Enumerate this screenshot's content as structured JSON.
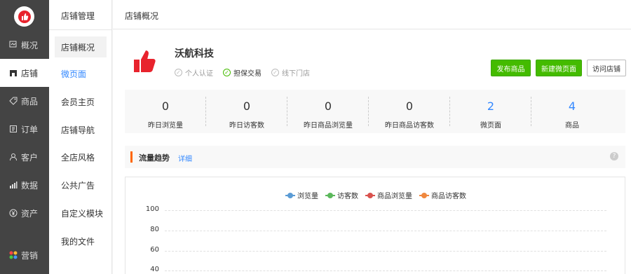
{
  "nav": {
    "items": [
      {
        "label": "概况",
        "icon": "overview-icon"
      },
      {
        "label": "店铺",
        "icon": "shop-icon"
      },
      {
        "label": "商品",
        "icon": "tag-icon"
      },
      {
        "label": "订单",
        "icon": "order-icon"
      },
      {
        "label": "客户",
        "icon": "user-icon"
      },
      {
        "label": "数据",
        "icon": "bar-chart-icon"
      },
      {
        "label": "资产",
        "icon": "yen-icon"
      },
      {
        "label": "营销",
        "icon": "apps-icon"
      }
    ],
    "active_index": 1
  },
  "subnav": {
    "title": "店铺管理",
    "items": [
      "店铺概况",
      "微页面",
      "会员主页",
      "店铺导航",
      "全店风格",
      "公共广告",
      "自定义模块",
      "我的文件"
    ]
  },
  "topbar": {
    "breadcrumb": "店铺概况"
  },
  "shop": {
    "name": "沃航科技",
    "certifications": [
      {
        "label": "个人认证",
        "verified": false
      },
      {
        "label": "担保交易",
        "verified": true
      },
      {
        "label": "线下门店",
        "verified": false
      }
    ]
  },
  "actions": {
    "publish": "发布商品",
    "new_page": "新建微页面",
    "visit": "访问店铺"
  },
  "stats": [
    {
      "value": "0",
      "label": "昨日浏览量"
    },
    {
      "value": "0",
      "label": "昨日访客数"
    },
    {
      "value": "0",
      "label": "昨日商品浏览量"
    },
    {
      "value": "0",
      "label": "昨日商品访客数"
    },
    {
      "value": "2",
      "label": "微页面"
    },
    {
      "value": "4",
      "label": "商品"
    }
  ],
  "trend": {
    "title": "流量趋势",
    "detail_link": "详细"
  },
  "colors": {
    "accent_green": "#44bb00",
    "link_blue": "#3388ff",
    "trend_marker": "#ff6600"
  },
  "chart_data": {
    "type": "line",
    "series": [
      {
        "name": "浏览量",
        "color": "#5b9bd5",
        "values": []
      },
      {
        "name": "访客数",
        "color": "#5cb85c",
        "values": []
      },
      {
        "name": "商品浏览量",
        "color": "#d9534f",
        "values": []
      },
      {
        "name": "商品访客数",
        "color": "#f0883e",
        "values": []
      }
    ],
    "yticks": [
      "100",
      "80",
      "60",
      "40"
    ],
    "grid": true,
    "legend_position": "top-center"
  }
}
